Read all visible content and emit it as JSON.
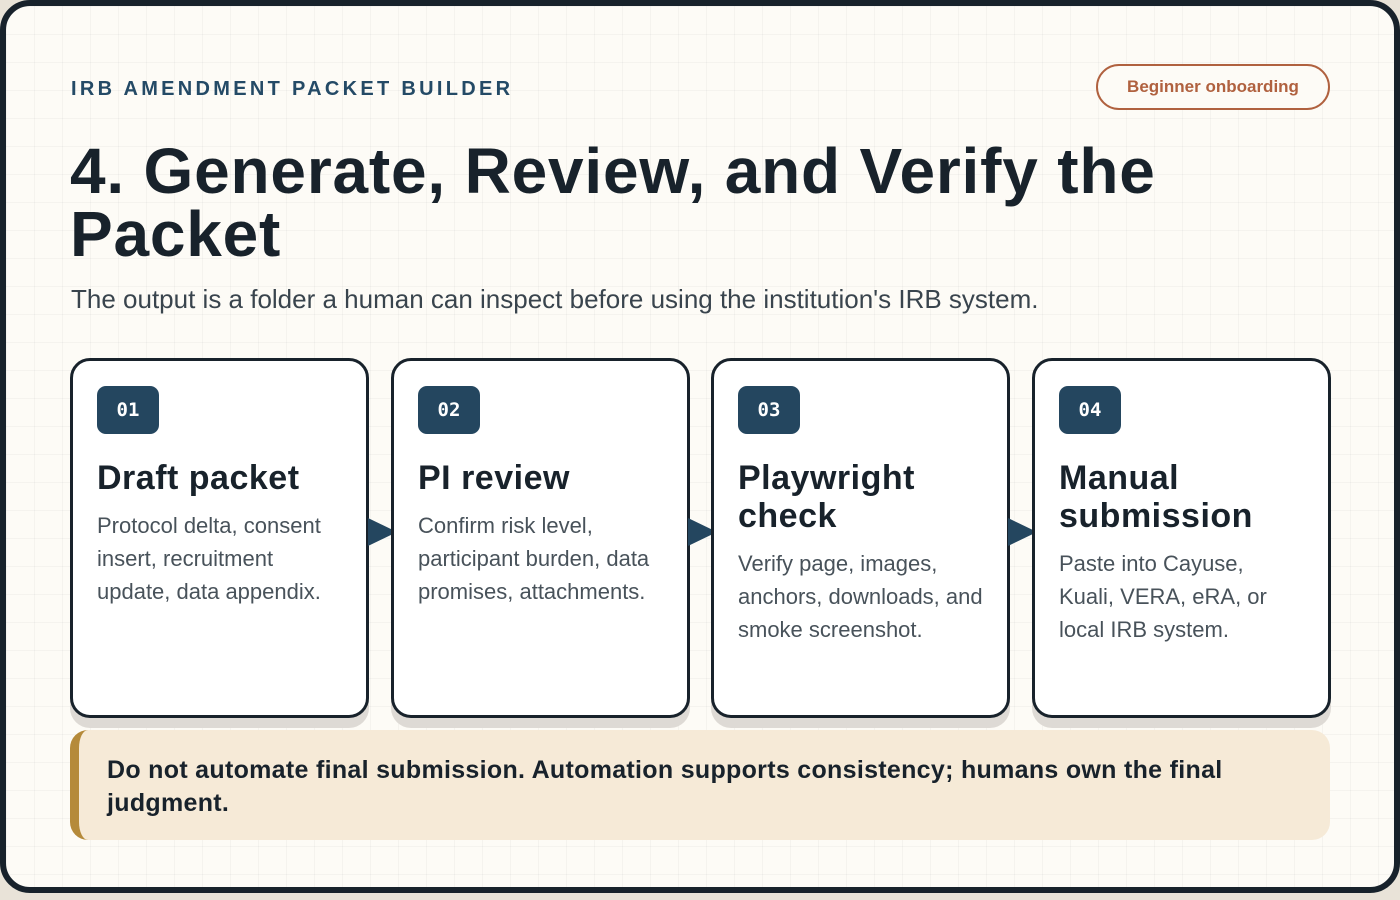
{
  "header": {
    "eyebrow": "IRB AMENDMENT PACKET BUILDER",
    "badge": "Beginner onboarding"
  },
  "title": "4. Generate, Review, and Verify the Packet",
  "subtitle": "The output is a folder a human can inspect before using the institution's IRB system.",
  "steps": [
    {
      "number": "01",
      "title": "Draft packet",
      "description": "Protocol delta, consent insert, recruitment update, data appendix."
    },
    {
      "number": "02",
      "title": "PI review",
      "description": "Confirm risk level, participant burden, data promises, attachments."
    },
    {
      "number": "03",
      "title": "Playwright check",
      "description": "Verify page, images, anchors, downloads, and smoke screenshot."
    },
    {
      "number": "04",
      "title": "Manual submission",
      "description": "Paste into Cayuse, Kuali, VERA, eRA, or local IRB system."
    }
  ],
  "note": "Do not automate final submission. Automation supports consistency; humans own the final judgment.",
  "colors": {
    "ink": "#18222b",
    "navy": "#24465f",
    "accent": "#b0613f",
    "note_bg": "#f6ead7",
    "note_bar": "#b58a3a"
  }
}
